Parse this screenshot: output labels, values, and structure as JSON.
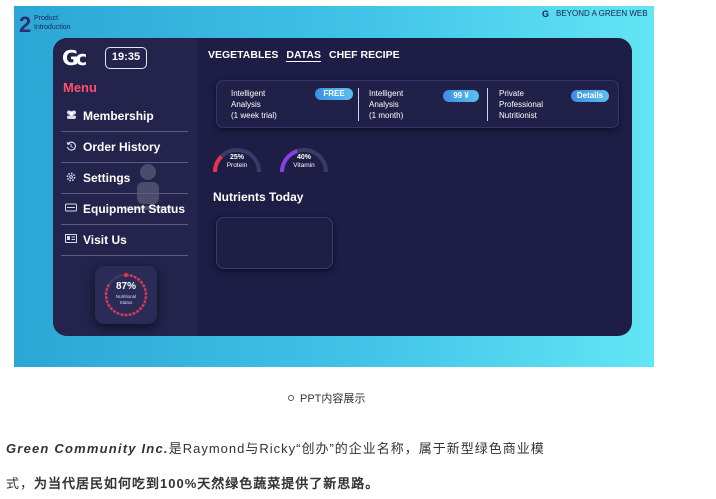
{
  "slide": {
    "number": "2",
    "subtitle_line1": "Product",
    "subtitle_line2": "Introduction",
    "brand_logo": "G",
    "brand_text": "BEYOND A GREEN WEB"
  },
  "app": {
    "logo": "Gc",
    "time": "19:35",
    "menu_title": "Menu",
    "menu": [
      {
        "label": "Membership",
        "icon": "members-icon"
      },
      {
        "label": "Order History",
        "icon": "history-icon"
      },
      {
        "label": "Settings",
        "icon": "gear-icon"
      },
      {
        "label": "Equipment Status",
        "icon": "equipment-icon"
      },
      {
        "label": "Visit Us",
        "icon": "id-card-icon"
      }
    ],
    "nutritional_status": {
      "percent": "87%",
      "label_line1": "Nutritional",
      "label_line2": "Status",
      "value": 0.87
    },
    "tabs": [
      {
        "label": "VEGETABLES",
        "active": false
      },
      {
        "label": "DATAS",
        "active": true
      },
      {
        "label": "CHEF RECIPE",
        "active": false
      }
    ],
    "plans": [
      {
        "line1": "Intelligent",
        "line2": "Analysis",
        "line3": "(1 week trial)",
        "button": "FREE"
      },
      {
        "line1": "Intelligent",
        "line2": "Analysis",
        "line3": "(1 month)",
        "button": "99 ¥"
      },
      {
        "line1": "Private",
        "line2": "Professional",
        "line3": "Nutritionist",
        "button": "Details"
      }
    ],
    "gauges": [
      {
        "percent": "25%",
        "name": "Protein",
        "value": 0.25,
        "color": "#e8334f"
      },
      {
        "percent": "40%",
        "name": "Vitamin",
        "value": 0.4,
        "color": "#8a3fe0"
      }
    ],
    "nutrients_title": "Nutrients  Today"
  },
  "caption": "PPT内容展示",
  "paragraph1": {
    "company": "Green Community Inc.",
    "rest": "是Raymond与Ricky“创办”的企业名称，属于新型绿色商业模"
  },
  "paragraph2": {
    "start": "式，",
    "bold": "为当代居民如何吃到100%天然绿色蔬菜提供了新思路。"
  },
  "colors": {
    "accent_red": "#ff4f6d",
    "app_bg": "#1d1d45",
    "pill_blue": "#4aa8ea"
  }
}
